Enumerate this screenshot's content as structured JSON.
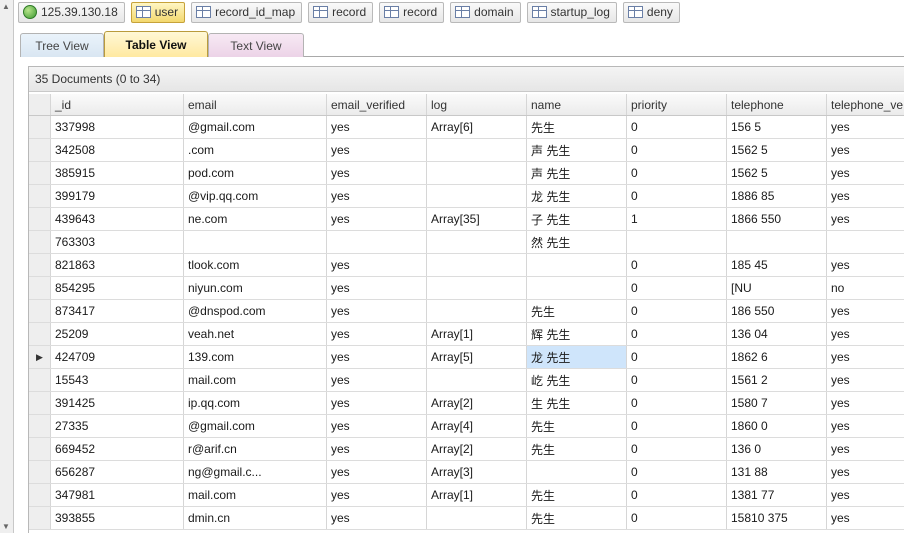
{
  "top_tabs": [
    {
      "label": "125.39.130.18",
      "icon": "server-globe-icon",
      "active": false
    },
    {
      "label": "user",
      "icon": "table-icon",
      "active": true
    },
    {
      "label": "record_id_map",
      "icon": "table-icon",
      "active": false
    },
    {
      "label": "record",
      "icon": "table-icon",
      "active": false
    },
    {
      "label": "record",
      "icon": "table-icon",
      "active": false
    },
    {
      "label": "domain",
      "icon": "table-icon",
      "active": false
    },
    {
      "label": "startup_log",
      "icon": "table-icon",
      "active": false
    },
    {
      "label": "deny",
      "icon": "table-icon",
      "active": false
    }
  ],
  "view_tabs": {
    "tree": "Tree View",
    "table": "Table View",
    "text": "Text View"
  },
  "doc_count": "35 Documents (0 to 34)",
  "columns": [
    "_id",
    "email",
    "email_verified",
    "log",
    "name",
    "priority",
    "telephone",
    "telephone_ve"
  ],
  "rows": [
    {
      "id": "337998",
      "email": "                @gmail.com",
      "ev": "yes",
      "log": "Array[6]",
      "name": "     先生",
      "pri": "0",
      "tel": "156        5",
      "tv": "yes"
    },
    {
      "id": "342508",
      "email": "            .com",
      "ev": "yes",
      "log": "",
      "name": "    声 先生",
      "pri": "0",
      "tel": "1562      5",
      "tv": "yes"
    },
    {
      "id": "385915",
      "email": "          pod.com",
      "ev": "yes",
      "log": "",
      "name": "    声 先生",
      "pri": "0",
      "tel": "1562      5",
      "tv": "yes"
    },
    {
      "id": "399179",
      "email": "         @vip.qq.com",
      "ev": "yes",
      "log": "",
      "name": "    龙 先生",
      "pri": "0",
      "tel": "1886     85",
      "tv": "yes"
    },
    {
      "id": "439643",
      "email": "          ne.com",
      "ev": "yes",
      "log": "Array[35]",
      "name": "    子 先生",
      "pri": "1",
      "tel": "1866     550",
      "tv": "yes"
    },
    {
      "id": "763303",
      "email": "",
      "ev": "",
      "log": "",
      "name": "    然 先生",
      "pri": "",
      "tel": "",
      "tv": ""
    },
    {
      "id": "821863",
      "email": "          tlook.com",
      "ev": "yes",
      "log": "",
      "name": "",
      "pri": "0",
      "tel": "185      45",
      "tv": "yes"
    },
    {
      "id": "854295",
      "email": "          niyun.com",
      "ev": "yes",
      "log": "",
      "name": "",
      "pri": "0",
      "tel": "[NU",
      "tv": "no"
    },
    {
      "id": "873417",
      "email": "         @dnspod.com",
      "ev": "yes",
      "log": "",
      "name": "    先生",
      "pri": "0",
      "tel": "186      550",
      "tv": "yes"
    },
    {
      "id": "25209",
      "email": "          veah.net",
      "ev": "yes",
      "log": "Array[1]",
      "name": "    辉 先生",
      "pri": "0",
      "tel": "136      04",
      "tv": "yes"
    },
    {
      "id": "424709",
      "email": "          139.com",
      "ev": "yes",
      "log": "Array[5]",
      "name": "    龙 先生",
      "pri": "0",
      "tel": "1862      6",
      "tv": "yes"
    },
    {
      "id": "15543",
      "email": "          mail.com",
      "ev": "yes",
      "log": "",
      "name": "    屹 先生",
      "pri": "0",
      "tel": "1561      2",
      "tv": "yes"
    },
    {
      "id": "391425",
      "email": "          ip.qq.com",
      "ev": "yes",
      "log": "Array[2]",
      "name": "    生 先生",
      "pri": "0",
      "tel": "1580      7",
      "tv": "yes"
    },
    {
      "id": "27335",
      "email": "         @gmail.com",
      "ev": "yes",
      "log": "Array[4]",
      "name": "    先生",
      "pri": "0",
      "tel": "1860      0",
      "tv": "yes"
    },
    {
      "id": "669452",
      "email": "          r@arif.cn",
      "ev": "yes",
      "log": "Array[2]",
      "name": "    先生",
      "pri": "0",
      "tel": "136      0",
      "tv": "yes"
    },
    {
      "id": "656287",
      "email": "          ng@gmail.c...",
      "ev": "yes",
      "log": "Array[3]",
      "name": "",
      "pri": "0",
      "tel": "131      88",
      "tv": "yes"
    },
    {
      "id": "347981",
      "email": "          mail.com",
      "ev": "yes",
      "log": "Array[1]",
      "name": "    先生",
      "pri": "0",
      "tel": "1381      77",
      "tv": "yes"
    },
    {
      "id": "393855",
      "email": "          dmin.cn",
      "ev": "yes",
      "log": "",
      "name": "    先生",
      "pri": "0",
      "tel": "15810     375",
      "tv": "yes"
    }
  ],
  "selected_row": 10,
  "selected_col": "name",
  "colors": {
    "active_tab": "#f3d86e",
    "selection": "#cfe5fb"
  }
}
